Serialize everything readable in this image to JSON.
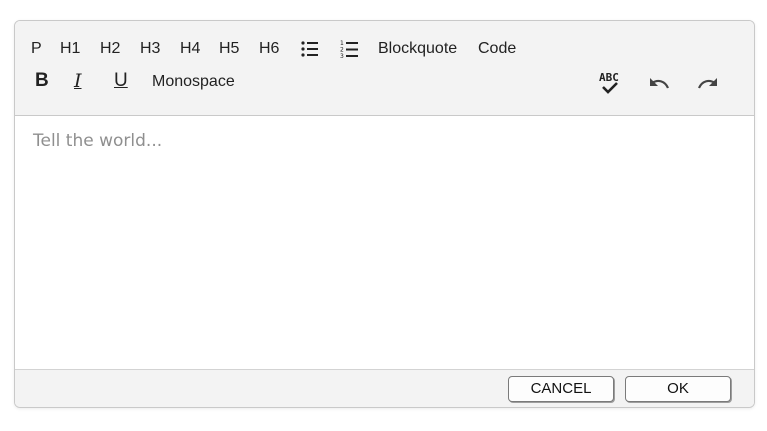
{
  "toolbar": {
    "blocks": {
      "p": "P",
      "h1": "H1",
      "h2": "H2",
      "h3": "H3",
      "h4": "H4",
      "h5": "H5",
      "h6": "H6",
      "blockquote": "Blockquote",
      "code": "Code"
    },
    "format": {
      "bold": "B",
      "italic": "I",
      "underline": "U",
      "monospace": "Monospace"
    },
    "icons": {
      "bullet_list": "unordered-list-icon",
      "numbered_list": "ordered-list-icon",
      "spellcheck": "spellcheck-icon",
      "undo": "undo-icon",
      "redo": "redo-icon"
    }
  },
  "editor": {
    "placeholder": "Tell the world..."
  },
  "footer": {
    "cancel_label": "CANCEL",
    "ok_label": "OK"
  },
  "colors": {
    "toolbar_bg": "#f3f3f3",
    "border": "#c9c9c9",
    "placeholder": "#8f8f8f"
  }
}
